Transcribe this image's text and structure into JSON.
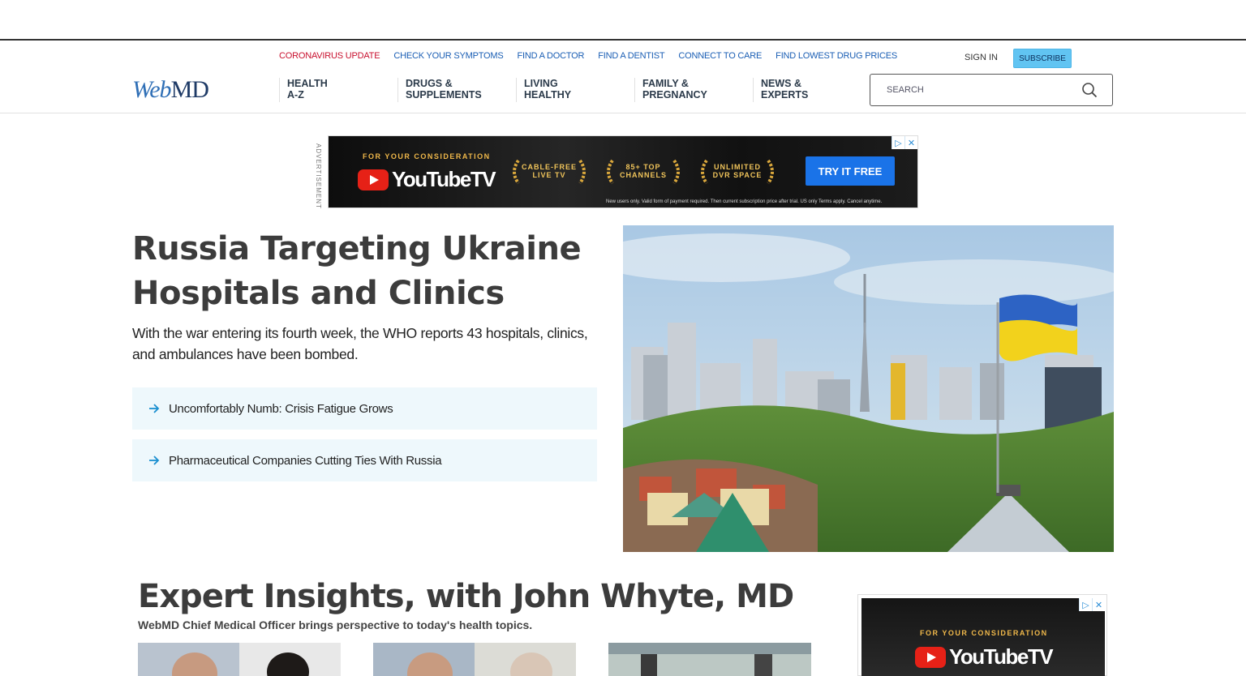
{
  "utility_links": [
    {
      "label": "CORONAVIRUS UPDATE",
      "alert": true
    },
    {
      "label": "CHECK YOUR SYMPTOMS"
    },
    {
      "label": "FIND A DOCTOR"
    },
    {
      "label": "FIND A DENTIST"
    },
    {
      "label": "CONNECT TO CARE"
    },
    {
      "label": "FIND LOWEST DRUG PRICES"
    }
  ],
  "account": {
    "signin": "SIGN IN",
    "subscribe": "SUBSCRIBE"
  },
  "logo": {
    "web": "Web",
    "md": "MD"
  },
  "nav": [
    {
      "line1": "HEALTH",
      "line2": "A-Z"
    },
    {
      "line1": "DRUGS &",
      "line2": "SUPPLEMENTS"
    },
    {
      "line1": "LIVING",
      "line2": "HEALTHY"
    },
    {
      "line1": "FAMILY &",
      "line2": "PREGNANCY"
    },
    {
      "line1": "NEWS &",
      "line2": "EXPERTS"
    }
  ],
  "search": {
    "placeholder": "SEARCH"
  },
  "ad_top": {
    "label": "ADVERTISEMENT",
    "consider": "FOR YOUR CONSIDERATION",
    "brand": "YouTubeTV",
    "badges": [
      "CABLE-FREE LIVE TV",
      "85+ TOP CHANNELS",
      "UNLIMITED DVR SPACE"
    ],
    "cta": "TRY IT FREE",
    "fine_print": "New users only. Valid form of payment required. Then current subscription price after trial. US only Terms apply. Cancel anytime.",
    "adchoice_play": "▷",
    "adchoice_close": "✕"
  },
  "feature": {
    "headline": "Russia Targeting Ukraine Hospitals and Clinics",
    "dek": "With the war entering its fourth week, the WHO reports 43 hospitals, clinics, and ambulances have been bombed.",
    "related": [
      "Uncomfortably Numb: Crisis Fatigue Grows",
      "Pharmaceutical Companies Cutting Ties With Russia"
    ]
  },
  "expert": {
    "title": "Expert Insights, with John Whyte, MD",
    "subtitle": "WebMD Chief Medical Officer brings perspective to today's health topics."
  },
  "ad_side": {
    "consider": "FOR YOUR CONSIDERATION",
    "brand": "YouTubeTV",
    "adchoice_play": "▷",
    "adchoice_close": "✕"
  },
  "colors": {
    "link": "#1a5eb4",
    "alert": "#c8102e",
    "subscribe": "#61c4f2",
    "related_bg": "#eef8fc",
    "arrow": "#1a8fd0"
  }
}
